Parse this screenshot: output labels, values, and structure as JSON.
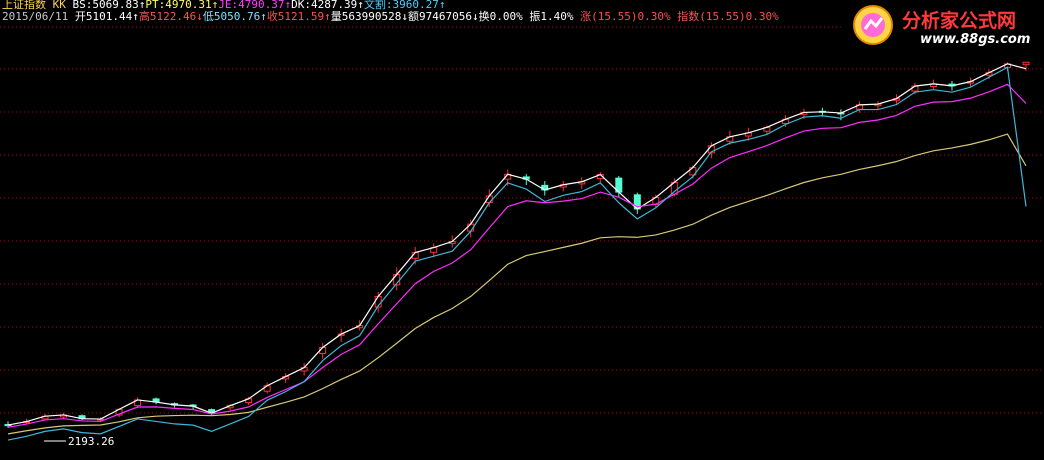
{
  "header": {
    "row1": [
      {
        "text": "上证指数 KK ",
        "color": "#ffd54a"
      },
      {
        "text": "BS:5069.83↑",
        "color": "#ffffff"
      },
      {
        "text": "PT:4970.31↑",
        "color": "#ffff66"
      },
      {
        "text": "JE:4790.37↑",
        "color": "#ff40ff"
      },
      {
        "text": "DK:4287.39↑",
        "color": "#ffffff"
      },
      {
        "text": "文割:3960.27↑",
        "color": "#4fd0ff"
      }
    ],
    "row2": [
      {
        "text": "2015/06/11 ",
        "color": "#c8c8c8"
      },
      {
        "text": "开5101.44↑",
        "color": "#ffffff"
      },
      {
        "text": "高5122.46↓",
        "color": "#ff5050"
      },
      {
        "text": "低5050.76↑",
        "color": "#7fe0ff"
      },
      {
        "text": "收5121.59↑",
        "color": "#ff5050"
      },
      {
        "text": "量563990528↓",
        "color": "#ffffff"
      },
      {
        "text": "额97467056↓",
        "color": "#ffffff"
      },
      {
        "text": "换0.00%",
        "color": "#ffffff"
      },
      {
        "text": " 振1.40%",
        "color": "#ffffff"
      },
      {
        "text": " 涨(15.55)0.30%",
        "color": "#ff5050"
      },
      {
        "text": " 指数(15.55)0.30%",
        "color": "#ff5050"
      }
    ]
  },
  "logo": {
    "title": "分析家公式网",
    "url": "www.88gs.com",
    "badge_icon": "analyst-logo-icon"
  },
  "chart_data": {
    "type": "candlestick",
    "min_label": "2193.26",
    "y_range": [
      2000,
      5300
    ],
    "colors": {
      "up": "#ff3030",
      "down": "#54ffd2",
      "ma_white": "#ffffff",
      "ma_purple": "#ff2cff",
      "ma_yellow": "#d6c878",
      "ma_cyan": "#3fb6d8",
      "grid": "#b30000"
    },
    "series": [
      {
        "name": "BS",
        "color": "#ffffff",
        "values": [
          2201,
          2229,
          2272,
          2282,
          2252,
          2249,
          2327,
          2403,
          2386,
          2363,
          2353,
          2296,
          2357,
          2412,
          2517,
          2591,
          2663,
          2825,
          2933,
          3001,
          3236,
          3412,
          3589,
          3629,
          3678,
          3818,
          4045,
          4219,
          4180,
          4093,
          4135,
          4159,
          4217,
          4076,
          3940,
          4033,
          4154,
          4273,
          4448,
          4521,
          4553,
          4597,
          4662,
          4717,
          4722,
          4712,
          4778,
          4784,
          4828,
          4929,
          4947,
          4931,
          4965,
          5037,
          5108,
          5069
        ]
      },
      {
        "name": "JE",
        "color": "#ff2cff",
        "values": [
          2183,
          2209,
          2242,
          2252,
          2234,
          2230,
          2289,
          2346,
          2347,
          2335,
          2326,
          2290,
          2313,
          2347,
          2423,
          2487,
          2549,
          2664,
          2770,
          2847,
          3015,
          3177,
          3338,
          3438,
          3505,
          3612,
          3788,
          3959,
          4006,
          3990,
          4003,
          4024,
          4076,
          4035,
          3958,
          3979,
          4058,
          4141,
          4268,
          4354,
          4401,
          4450,
          4512,
          4567,
          4589,
          4594,
          4637,
          4656,
          4693,
          4766,
          4800,
          4804,
          4832,
          4883,
          4943,
          4790
        ]
      },
      {
        "name": "DK",
        "color": "#d6c878",
        "values": [
          2130,
          2155,
          2178,
          2194,
          2198,
          2201,
          2227,
          2259,
          2272,
          2277,
          2280,
          2276,
          2286,
          2303,
          2344,
          2384,
          2427,
          2494,
          2568,
          2636,
          2743,
          2859,
          2978,
          3067,
          3139,
          3236,
          3364,
          3495,
          3565,
          3597,
          3631,
          3664,
          3708,
          3717,
          3712,
          3731,
          3770,
          3817,
          3890,
          3952,
          4001,
          4049,
          4102,
          4153,
          4191,
          4219,
          4258,
          4288,
          4322,
          4370,
          4408,
          4431,
          4460,
          4497,
          4543,
          4287
        ]
      },
      {
        "name": "文割",
        "color": "#3fb6d8",
        "values": [
          2080,
          2110,
          2150,
          2170,
          2140,
          2130,
          2190,
          2250,
          2230,
          2210,
          2200,
          2150,
          2210,
          2270,
          2400,
          2470,
          2550,
          2720,
          2840,
          2920,
          3160,
          3340,
          3520,
          3560,
          3600,
          3760,
          3990,
          4150,
          4100,
          4000,
          4050,
          4080,
          4150,
          3990,
          3860,
          3950,
          4080,
          4200,
          4400,
          4470,
          4500,
          4540,
          4620,
          4680,
          4690,
          4670,
          4740,
          4740,
          4780,
          4880,
          4900,
          4880,
          4920,
          5000,
          5080,
          3960
        ]
      }
    ],
    "candles": [
      [
        2205,
        2201,
        2231,
        2178
      ],
      [
        2224,
        2229,
        2251,
        2207
      ],
      [
        2250,
        2272,
        2291,
        2237
      ],
      [
        2266,
        2282,
        2299,
        2252
      ],
      [
        2276,
        2252,
        2286,
        2240
      ],
      [
        2242,
        2249,
        2262,
        2231
      ],
      [
        2281,
        2327,
        2336,
        2262
      ],
      [
        2358,
        2403,
        2424,
        2338
      ],
      [
        2411,
        2386,
        2423,
        2367
      ],
      [
        2373,
        2363,
        2383,
        2342
      ],
      [
        2362,
        2353,
        2370,
        2325
      ],
      [
        2325,
        2296,
        2334,
        2282
      ],
      [
        2340,
        2357,
        2369,
        2321
      ],
      [
        2381,
        2412,
        2428,
        2363
      ],
      [
        2473,
        2517,
        2543,
        2455
      ],
      [
        2572,
        2591,
        2618,
        2540
      ],
      [
        2636,
        2663,
        2701,
        2599
      ],
      [
        2777,
        2825,
        2862,
        2735
      ],
      [
        2923,
        2933,
        2977,
        2869
      ],
      [
        2984,
        3001,
        3044,
        2961
      ],
      [
        3151,
        3236,
        3272,
        3105
      ],
      [
        3329,
        3412,
        3470,
        3285
      ],
      [
        3543,
        3589,
        3635,
        3494
      ],
      [
        3591,
        3629,
        3664,
        3552
      ],
      [
        3663,
        3678,
        3727,
        3629
      ],
      [
        3762,
        3818,
        3853,
        3712
      ],
      [
        3992,
        4045,
        4097,
        3956
      ],
      [
        4180,
        4219,
        4258,
        4128
      ],
      [
        4198,
        4180,
        4221,
        4133
      ],
      [
        4130,
        4093,
        4164,
        4048
      ],
      [
        4117,
        4135,
        4167,
        4081
      ],
      [
        4142,
        4159,
        4195,
        4102
      ],
      [
        4185,
        4217,
        4238,
        4152
      ],
      [
        4188,
        4076,
        4205,
        4034
      ],
      [
        4054,
        3940,
        4072,
        3900
      ],
      [
        3977,
        4033,
        4055,
        3946
      ],
      [
        4059,
        4154,
        4187,
        4041
      ],
      [
        4214,
        4273,
        4292,
        4185
      ],
      [
        4392,
        4448,
        4477,
        4348
      ],
      [
        4485,
        4521,
        4571,
        4456
      ],
      [
        4527,
        4553,
        4594,
        4490
      ],
      [
        4566,
        4597,
        4612,
        4541
      ],
      [
        4628,
        4662,
        4695,
        4600
      ],
      [
        4702,
        4717,
        4746,
        4665
      ],
      [
        4726,
        4722,
        4755,
        4683
      ],
      [
        4713,
        4712,
        4742,
        4654
      ],
      [
        4743,
        4778,
        4805,
        4715
      ],
      [
        4771,
        4784,
        4808,
        4741
      ],
      [
        4815,
        4828,
        4862,
        4787
      ],
      [
        4889,
        4929,
        4955,
        4862
      ],
      [
        4926,
        4947,
        4981,
        4907
      ],
      [
        4945,
        4931,
        4970,
        4893
      ],
      [
        4953,
        4965,
        4997,
        4925
      ],
      [
        5017,
        5037,
        5063,
        4985
      ],
      [
        5078,
        5108,
        5121,
        5050
      ],
      [
        5101,
        5121,
        5122,
        5050
      ]
    ]
  }
}
